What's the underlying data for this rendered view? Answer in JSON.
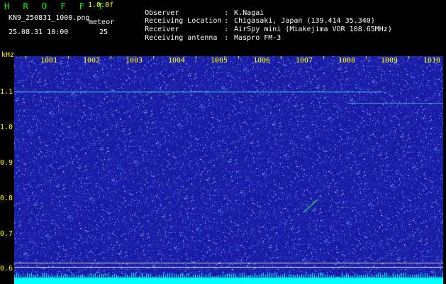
{
  "header": {
    "brand": "H R O F F T",
    "version": "1.0.0f",
    "filename": "KN9_250831_1000.png",
    "meteor_label": "meteor",
    "timestamp": "25.08.31 10:00",
    "meteor_count": "25"
  },
  "meta": [
    {
      "key": "Observer",
      "value": "K.Nagai"
    },
    {
      "key": "Receiving Location",
      "value": "Chigasaki, Japan (139.414 35.340)"
    },
    {
      "key": "Receiver",
      "value": "AirSpy mini (Miakejima VOR 108.65MHz)"
    },
    {
      "key": "Receiving antenna",
      "value": "Maspro FM-3"
    }
  ],
  "axes": {
    "y_unit": "kHz",
    "y_ticks": [
      "1.1",
      "1.0",
      "0.9",
      "0.8",
      "0.7",
      "0.6"
    ],
    "x_ticks": [
      "1001",
      "1002",
      "1003",
      "1004",
      "1005",
      "1006",
      "1007",
      "1008",
      "1009",
      "1010"
    ]
  },
  "colors": {
    "background": "#000000",
    "spectrum_base": "#1a1aa0",
    "label_yellow": "#ffff00",
    "brand_green": "#00ff00",
    "trace_cyan": "#66ffff"
  }
}
